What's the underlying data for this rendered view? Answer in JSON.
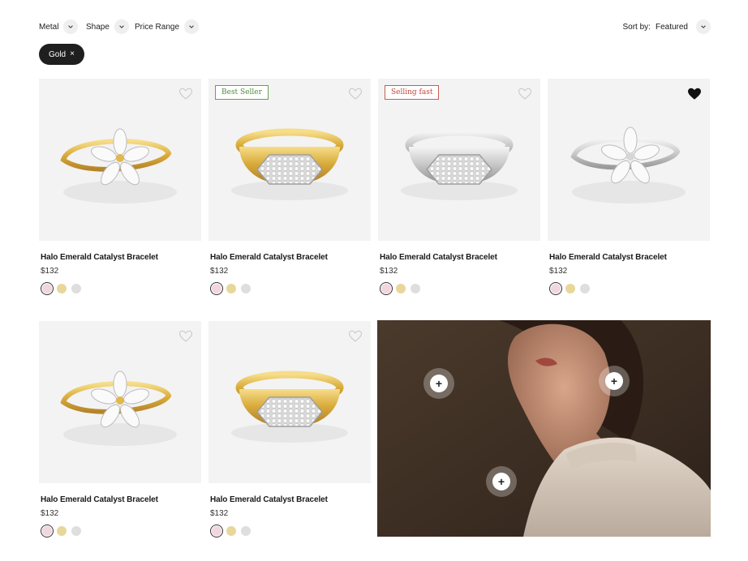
{
  "filters": {
    "metal": "Metal",
    "shape": "Shape",
    "price_range": "Price Range"
  },
  "sort": {
    "label": "Sort by:",
    "value": "Featured"
  },
  "active_chip": {
    "label": "Gold",
    "remove": "×"
  },
  "products": [
    {
      "title": "Halo Emerald Catalyst Bracelet",
      "price": "$132",
      "badge": "",
      "ring": "flower-gold",
      "favorited": false
    },
    {
      "title": "Halo Emerald Catalyst Bracelet",
      "price": "$132",
      "badge": "Best Seller",
      "ring": "signet-gold",
      "favorited": false
    },
    {
      "title": "Halo Emerald Catalyst Bracelet",
      "price": "$132",
      "badge": "Selling fast",
      "ring": "signet-silver",
      "favorited": false
    },
    {
      "title": "Halo Emerald Catalyst Bracelet",
      "price": "$132",
      "badge": "",
      "ring": "flower-silver",
      "favorited": true
    },
    {
      "title": "Halo Emerald Catalyst Bracelet",
      "price": "$132",
      "badge": "",
      "ring": "flower-gold",
      "favorited": false
    },
    {
      "title": "Halo Emerald Catalyst Bracelet",
      "price": "$132",
      "badge": "",
      "ring": "signet-gold",
      "favorited": false
    }
  ],
  "swatch_colors": {
    "rose": "#f2d6de",
    "yellow": "#e8d79a",
    "white": "#dedede"
  },
  "hotspot_symbol": "+",
  "colors": {
    "badge_best": "#4d8a3a",
    "badge_fast": "#c0473a",
    "chip_bg": "#1f1f1f"
  }
}
